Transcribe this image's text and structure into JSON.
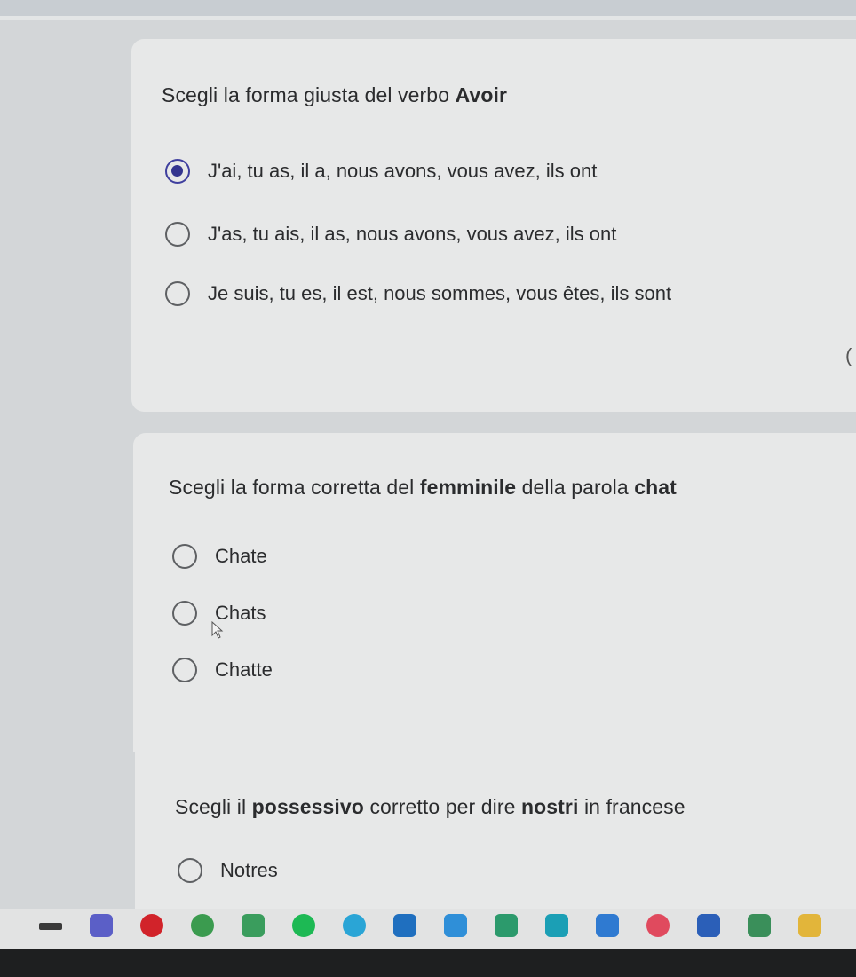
{
  "questions": [
    {
      "title_parts": [
        {
          "text": "Scegli la forma giusta del verbo ",
          "bold": false
        },
        {
          "text": "Avoir",
          "bold": true
        }
      ],
      "options": [
        {
          "label": "J'ai, tu as, il a, nous avons, vous avez, ils ont",
          "selected": true
        },
        {
          "label": "J'as, tu ais, il as, nous avons, vous avez, ils ont",
          "selected": false
        },
        {
          "label": "Je suis, tu es, il est, nous sommes, vous êtes, ils sont",
          "selected": false
        }
      ]
    },
    {
      "title_parts": [
        {
          "text": "Scegli la forma corretta del ",
          "bold": false
        },
        {
          "text": "femminile",
          "bold": true
        },
        {
          "text": " della parola ",
          "bold": false
        },
        {
          "text": "chat",
          "bold": true
        }
      ],
      "options": [
        {
          "label": "Chate",
          "selected": false
        },
        {
          "label": "Chats",
          "selected": false
        },
        {
          "label": "Chatte",
          "selected": false
        }
      ]
    },
    {
      "title_parts": [
        {
          "text": "Scegli il ",
          "bold": false
        },
        {
          "text": "possessivo",
          "bold": true
        },
        {
          "text": " corretto per dire ",
          "bold": false
        },
        {
          "text": "nostri",
          "bold": true
        },
        {
          "text": " in francese",
          "bold": false
        }
      ],
      "options": [
        {
          "label": "Notres",
          "selected": false
        }
      ]
    }
  ],
  "taskbar_icons": [
    {
      "name": "widget-icon",
      "color": "#3a3a3a"
    },
    {
      "name": "teams-icon",
      "color": "#5b5fc7"
    },
    {
      "name": "pinterest-icon",
      "color": "#d1232a"
    },
    {
      "name": "chrome-icon",
      "color": "#3b9b4f"
    },
    {
      "name": "classroom-icon",
      "color": "#3a9d5d"
    },
    {
      "name": "spotify-icon",
      "color": "#1db954"
    },
    {
      "name": "telegram-icon",
      "color": "#2aa5d6"
    },
    {
      "name": "outlook-icon",
      "color": "#1f6fbf"
    },
    {
      "name": "calendar-icon",
      "color": "#2f8fd8"
    },
    {
      "name": "maps-icon",
      "color": "#2c9a6c"
    },
    {
      "name": "edge-icon",
      "color": "#1b9fb5"
    },
    {
      "name": "store-icon",
      "color": "#2f7ad1"
    },
    {
      "name": "opera-icon",
      "color": "#e04a5e"
    },
    {
      "name": "word-icon",
      "color": "#2b5fb8"
    },
    {
      "name": "chrome-profile-icon",
      "color": "#3a8f5a"
    },
    {
      "name": "files-icon",
      "color": "#e2b53a"
    }
  ],
  "colors": {
    "accent": "#34358f",
    "card": "#e7e8e8",
    "background": "#d3d6d8"
  }
}
